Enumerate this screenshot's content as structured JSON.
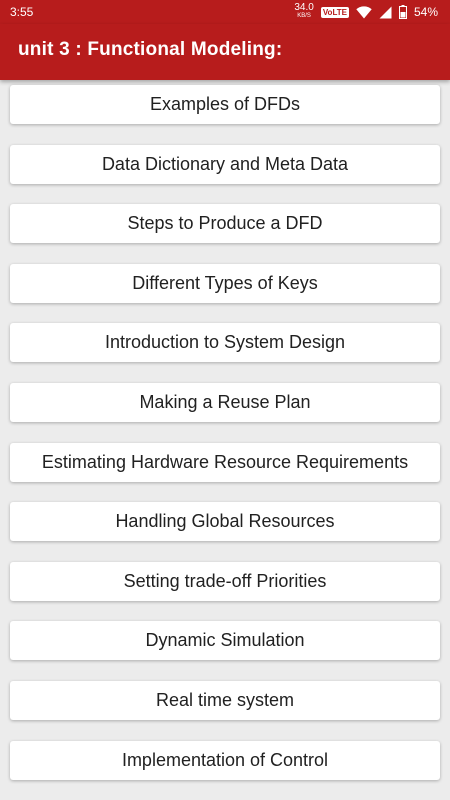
{
  "status_bar": {
    "time": "3:55",
    "net_speed": "34.0",
    "net_speed_unit": "KB/S",
    "volte": "VoLTE",
    "battery": "54%"
  },
  "app_bar": {
    "title": "unit 3 : Functional Modeling:"
  },
  "topics": [
    "Examples of DFDs",
    "Data Dictionary and Meta Data",
    "Steps to Produce a DFD",
    "Different Types of Keys",
    "Introduction to System Design",
    "Making a Reuse Plan",
    "Estimating Hardware Resource Requirements",
    "Handling Global Resources",
    "Setting trade-off Priorities",
    "Dynamic Simulation",
    "Real time system",
    "Implementation of Control"
  ],
  "colors": {
    "primary": "#b71c1c",
    "background": "#ececec",
    "card": "#ffffff",
    "text": "#212121"
  },
  "icons": [
    "wifi-icon",
    "signal-icon",
    "battery-icon"
  ]
}
